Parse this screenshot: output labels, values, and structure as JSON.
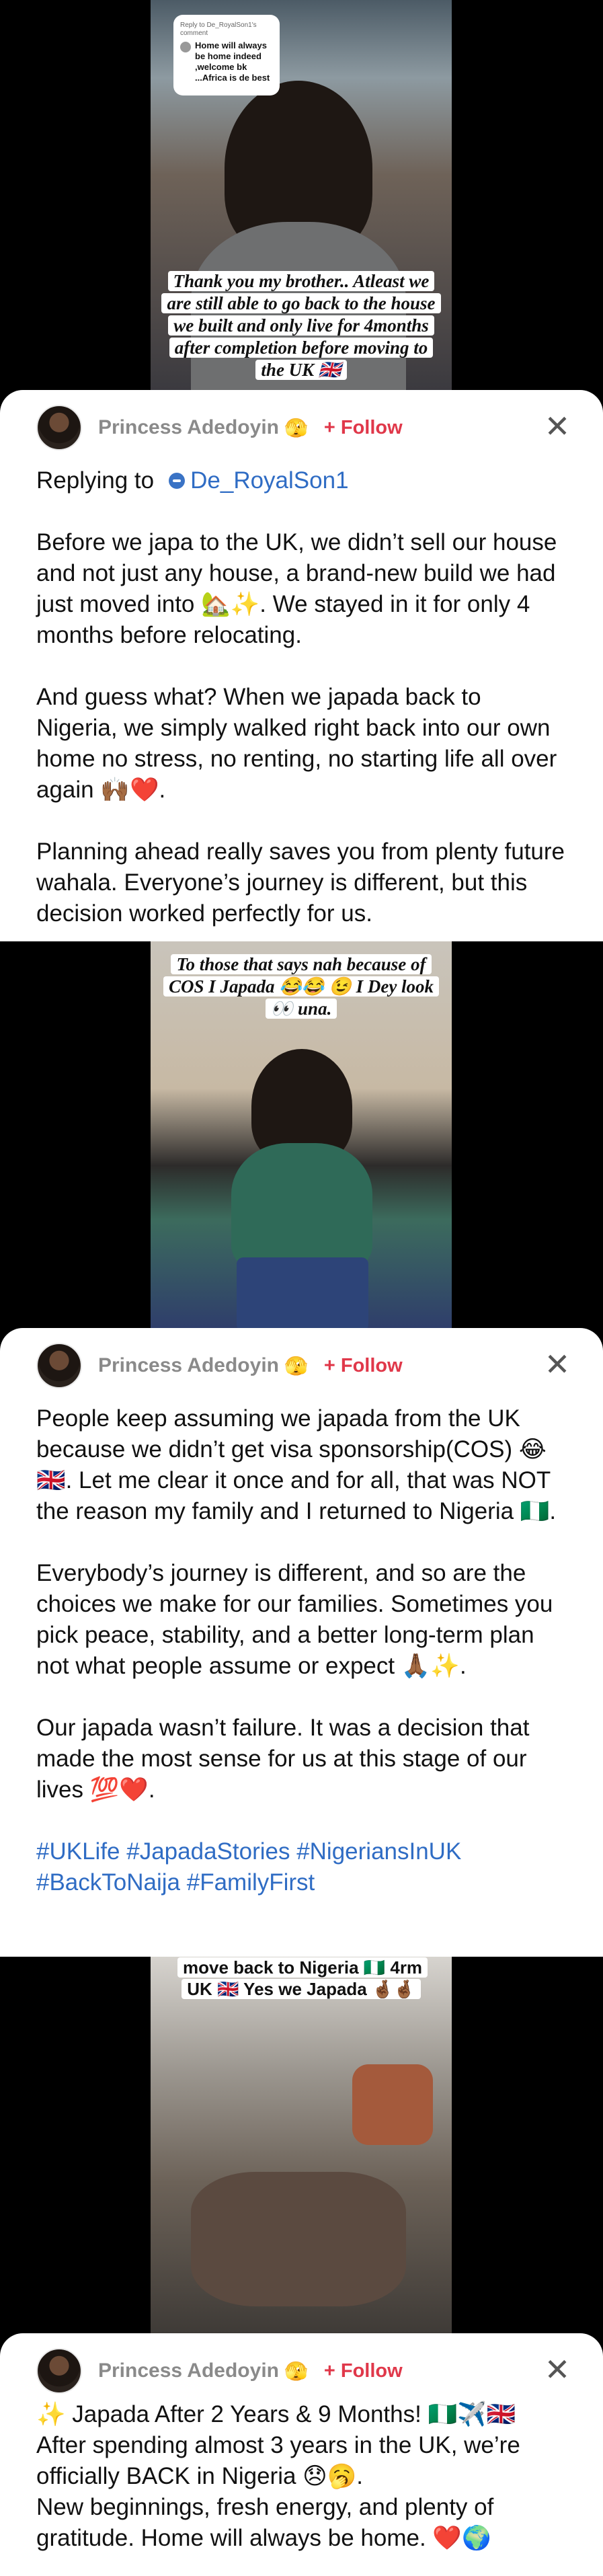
{
  "posts": [
    {
      "overlay_reply": {
        "small": "Reply to De_RoyalSon1's comment",
        "message": "Home will always be home indeed ,welcome bk ...Africa is de best"
      },
      "caption": "Thank you my brother.. Atleast we are still able to go back to the house we built and only live for 4months after completion before moving to the UK 🇬🇧",
      "author": "Princess Adedoyin",
      "author_emoji": "🫣",
      "follow": "+ Follow",
      "replying_label": "Replying to",
      "replying_handle": "De_RoyalSon1",
      "paragraphs": [
        "Before we japa to the UK, we didn’t sell our house and not just any house, a brand-new build we had just moved into 🏡✨. We stayed in it for only 4 months before relocating.",
        "And guess what? When we japada back to Nigeria, we simply walked right back into our own home no stress, no renting, no starting life all over again 🙌🏾❤️.",
        "Planning ahead really saves you from plenty future wahala. Everyone’s journey is different, but this decision worked perfectly for us."
      ]
    },
    {
      "caption": "To those that says nah because of COS I Japada 😂😂 😉 I Dey look 👀 una.",
      "author": "Princess Adedoyin",
      "author_emoji": "🫣",
      "follow": "+ Follow",
      "paragraphs": [
        "People keep assuming we japada from the UK because we didn’t get visa sponsorship(COS) 😂🇬🇧. Let me clear it once and for all, that was NOT the reason my family and I returned to Nigeria 🇳🇬.",
        "Everybody’s journey is different, and so are the choices we make for our families. Sometimes you pick peace, stability, and a better long-term plan not what people assume or expect 🙏🏾✨.",
        "Our japada wasn’t failure. It was a decision that made the most sense for us at this stage of our lives 💯❤️."
      ],
      "hashtags": "#UKLife #JapadaStories #NigeriansInUK #BackToNaija #FamilyFirst"
    },
    {
      "caption": "move back to Nigeria 🇳🇬 4rm UK 🇬🇧 Yes we Japada 🤞🏾🤞🏾",
      "author": "Princess Adedoyin",
      "author_emoji": "🫣",
      "follow": "+ Follow",
      "paragraphs": [
        "✨ Japada After 2 Years & 9 Months! 🇳🇬✈️🇬🇧\nAfter spending almost 3 years in the UK, we’re officially BACK in Nigeria 😞🥱.\nNew beginnings, fresh energy, and plenty of gratitude. Home will always be home. ❤️🌍"
      ]
    }
  ],
  "icons": {
    "close": "close-icon",
    "avatar": "avatar",
    "mention": "mention-icon"
  },
  "colors": {
    "follow": "#e0384a",
    "link": "#2f6cc4",
    "author": "#8a8a8a"
  }
}
